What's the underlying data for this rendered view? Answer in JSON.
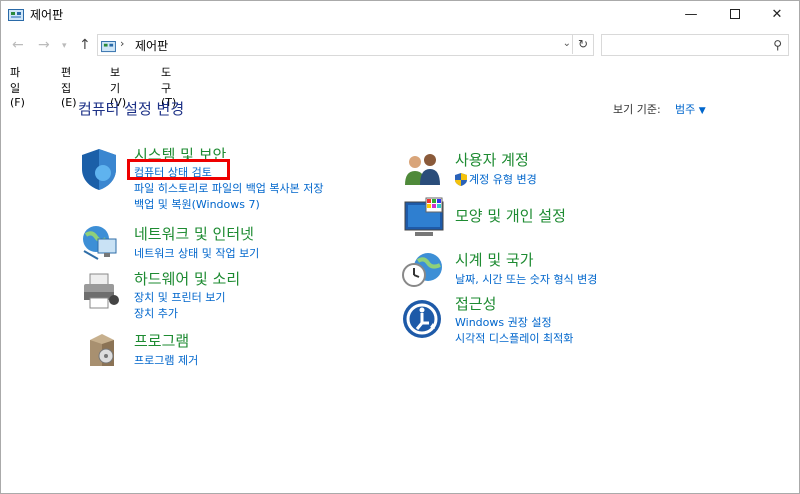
{
  "window": {
    "title": "제어판"
  },
  "address": {
    "crumb": "제어판"
  },
  "search": {
    "placeholder": "",
    "value": ""
  },
  "menu": [
    "파일(F)",
    "편집(E)",
    "보기(V)",
    "도구(T)"
  ],
  "main": {
    "heading": "컴퓨터 설정 변경",
    "view_by_label": "보기 기준:",
    "view_by_value": "범주"
  },
  "categories_left": [
    {
      "title": "시스템 및 보안",
      "links": [
        "컴퓨터 상태 검토",
        "파일 히스토리로 파일의 백업 복사본 저장",
        "백업 및 복원(Windows 7)"
      ]
    },
    {
      "title": "네트워크 및 인터넷",
      "links": [
        "네트워크 상태 및 작업 보기"
      ]
    },
    {
      "title": "하드웨어 및 소리",
      "links": [
        "장치 및 프린터 보기",
        "장치 추가"
      ]
    },
    {
      "title": "프로그램",
      "links": [
        "프로그램 제거"
      ]
    }
  ],
  "categories_right": [
    {
      "title": "사용자 계정",
      "links": [
        "계정 유형 변경"
      ]
    },
    {
      "title": "모양 및 개인 설정",
      "links": []
    },
    {
      "title": "시계 및 국가",
      "links": [
        "날짜, 시간 또는 숫자 형식 변경"
      ]
    },
    {
      "title": "접근성",
      "links": [
        "Windows 권장 설정",
        "시각적 디스플레이 최적화"
      ]
    }
  ]
}
